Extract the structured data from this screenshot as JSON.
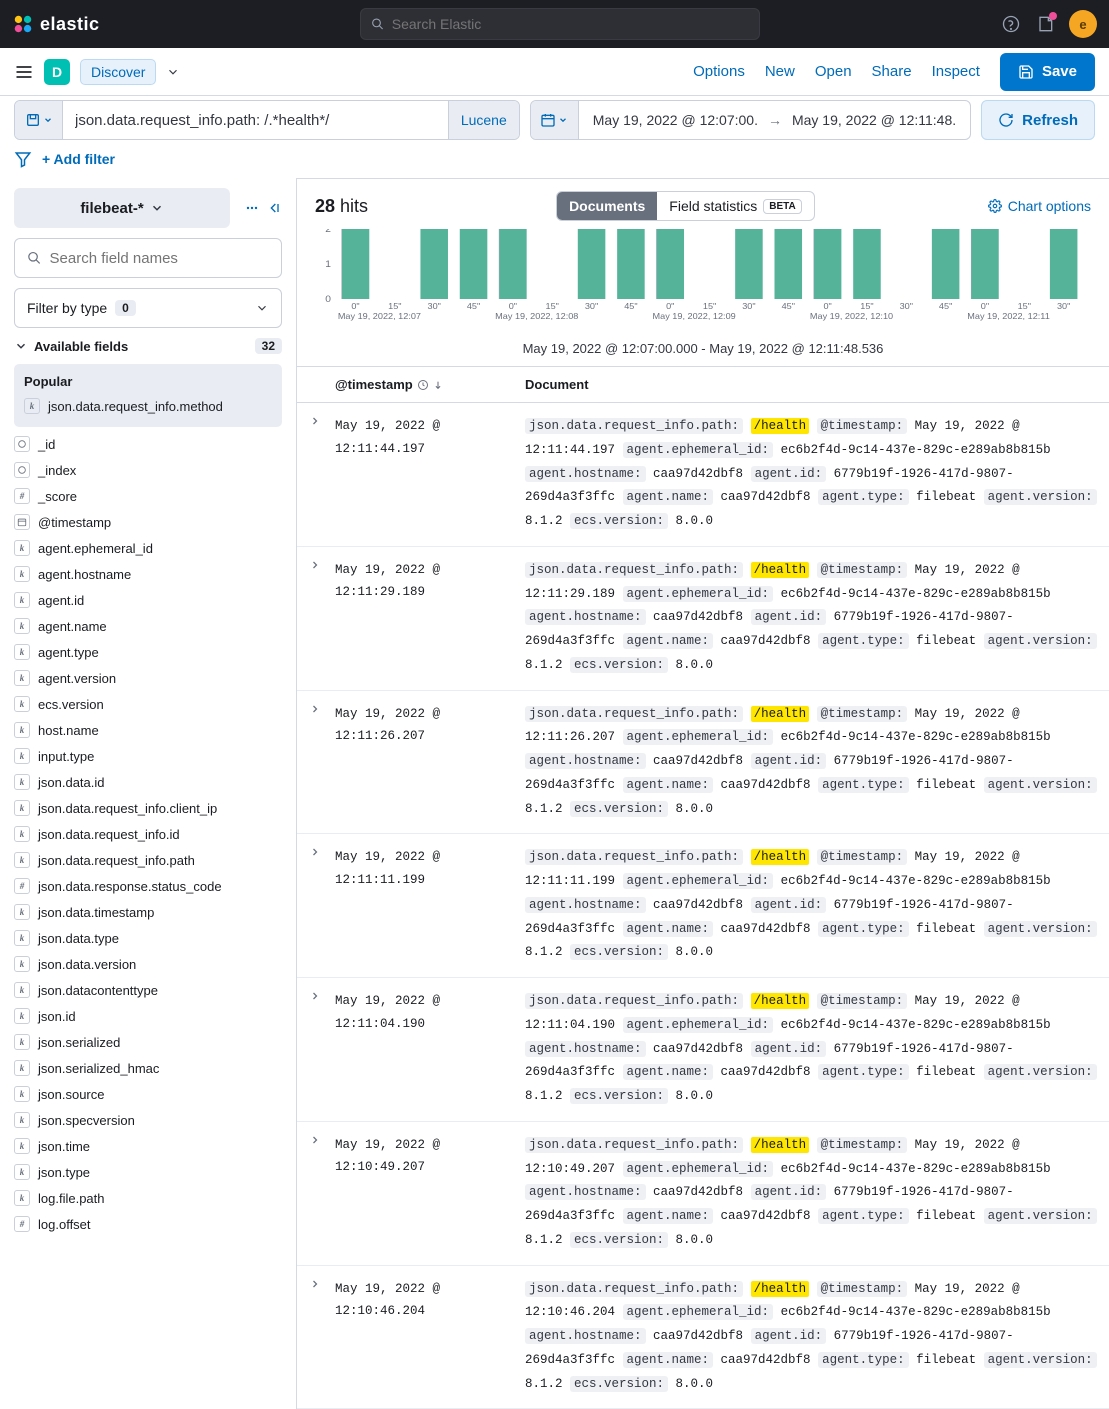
{
  "top": {
    "brand": "elastic",
    "search_placeholder": "Search Elastic",
    "avatar_letter": "e"
  },
  "sub": {
    "d_letter": "D",
    "discover": "Discover",
    "links": [
      "Options",
      "New",
      "Open",
      "Share",
      "Inspect"
    ],
    "save": "Save"
  },
  "query": {
    "value": "json.data.request_info.path: /.*health*/",
    "syntax": "Lucene",
    "from": "May 19, 2022 @ 12:07:00.",
    "to": "May 19, 2022 @ 12:11:48.",
    "refresh": "Refresh",
    "add_filter": "+ Add filter"
  },
  "sidebar": {
    "index": "filebeat-*",
    "field_search_placeholder": "Search field names",
    "filter_type_label": "Filter by type",
    "filter_type_count": "0",
    "available_label": "Available fields",
    "available_count": "32",
    "popular_label": "Popular",
    "popular_fields": [
      {
        "t": "k",
        "n": "json.data.request_info.method"
      }
    ],
    "fields": [
      {
        "t": "o",
        "n": "_id"
      },
      {
        "t": "o",
        "n": "_index"
      },
      {
        "t": "#",
        "n": "_score"
      },
      {
        "t": "d",
        "n": "@timestamp"
      },
      {
        "t": "k",
        "n": "agent.ephemeral_id"
      },
      {
        "t": "k",
        "n": "agent.hostname"
      },
      {
        "t": "k",
        "n": "agent.id"
      },
      {
        "t": "k",
        "n": "agent.name"
      },
      {
        "t": "k",
        "n": "agent.type"
      },
      {
        "t": "k",
        "n": "agent.version"
      },
      {
        "t": "k",
        "n": "ecs.version"
      },
      {
        "t": "k",
        "n": "host.name"
      },
      {
        "t": "k",
        "n": "input.type"
      },
      {
        "t": "k",
        "n": "json.data.id"
      },
      {
        "t": "k",
        "n": "json.data.request_info.client_ip"
      },
      {
        "t": "k",
        "n": "json.data.request_info.id"
      },
      {
        "t": "k",
        "n": "json.data.request_info.path"
      },
      {
        "t": "#",
        "n": "json.data.response.status_code"
      },
      {
        "t": "k",
        "n": "json.data.timestamp"
      },
      {
        "t": "k",
        "n": "json.data.type"
      },
      {
        "t": "k",
        "n": "json.data.version"
      },
      {
        "t": "k",
        "n": "json.datacontenttype"
      },
      {
        "t": "k",
        "n": "json.id"
      },
      {
        "t": "k",
        "n": "json.serialized"
      },
      {
        "t": "k",
        "n": "json.serialized_hmac"
      },
      {
        "t": "k",
        "n": "json.source"
      },
      {
        "t": "k",
        "n": "json.specversion"
      },
      {
        "t": "k",
        "n": "json.time"
      },
      {
        "t": "k",
        "n": "json.type"
      },
      {
        "t": "k",
        "n": "log.file.path"
      },
      {
        "t": "#",
        "n": "log.offset"
      }
    ]
  },
  "results": {
    "hits": "28",
    "hits_label": "hits",
    "view_documents": "Documents",
    "view_field_stats": "Field statistics",
    "beta": "BETA",
    "chart_options": "Chart options",
    "histo_caption": "May 19, 2022 @ 12:07:00.000 - May 19, 2022 @ 12:11:48.536",
    "col_ts": "@timestamp",
    "col_doc": "Document",
    "common": {
      "path": "/health",
      "ephemeral_id": "ec6b2f4d-9c14-437e-829c-e289ab8b815b",
      "hostname": "caa97d42dbf8",
      "agent_id": "6779b19f-1926-417d-9807-269d4a3f3ffc",
      "agent_name": "caa97d42dbf8",
      "agent_type": "filebeat",
      "agent_version": "8.1.2",
      "ecs_version": "8.0.0"
    },
    "rows": [
      {
        "ts": "May 19, 2022 @ 12:11:44.197",
        "at": "May 19, 2022 @ 12:11:44.197"
      },
      {
        "ts": "May 19, 2022 @ 12:11:29.189",
        "at": "May 19, 2022 @ 12:11:29.189"
      },
      {
        "ts": "May 19, 2022 @ 12:11:26.207",
        "at": "May 19, 2022 @ 12:11:26.207"
      },
      {
        "ts": "May 19, 2022 @ 12:11:11.199",
        "at": "May 19, 2022 @ 12:11:11.199"
      },
      {
        "ts": "May 19, 2022 @ 12:11:04.190",
        "at": "May 19, 2022 @ 12:11:04.190"
      },
      {
        "ts": "May 19, 2022 @ 12:10:49.207",
        "at": "May 19, 2022 @ 12:10:49.207"
      },
      {
        "ts": "May 19, 2022 @ 12:10:46.204",
        "at": "May 19, 2022 @ 12:10:46.204"
      }
    ]
  },
  "chart_data": {
    "type": "bar",
    "title": "",
    "xlabel": "May 19, 2022 @ 12:07:00.000 - May 19, 2022 @ 12:11:48.536",
    "ylabel": "",
    "ylim": [
      0,
      2
    ],
    "yticks": [
      0,
      1,
      2
    ],
    "xticks": [
      "0\"",
      "15\"",
      "30\"",
      "45\"",
      "0\"",
      "15\"",
      "30\"",
      "45\"",
      "0\"",
      "15\"",
      "30\"",
      "45\"",
      "0\"",
      "15\"",
      "30\"",
      "45\"",
      "0\"",
      "15\"",
      "30\""
    ],
    "xtick_minutes": [
      "May 19, 2022, 12:07",
      "May 19, 2022, 12:08",
      "May 19, 2022, 12:09",
      "May 19, 2022, 12:10",
      "May 19, 2022, 12:11"
    ],
    "values": [
      2,
      0,
      2,
      2,
      2,
      0,
      2,
      2,
      2,
      0,
      2,
      2,
      2,
      2,
      0,
      2,
      2,
      0,
      2
    ]
  }
}
